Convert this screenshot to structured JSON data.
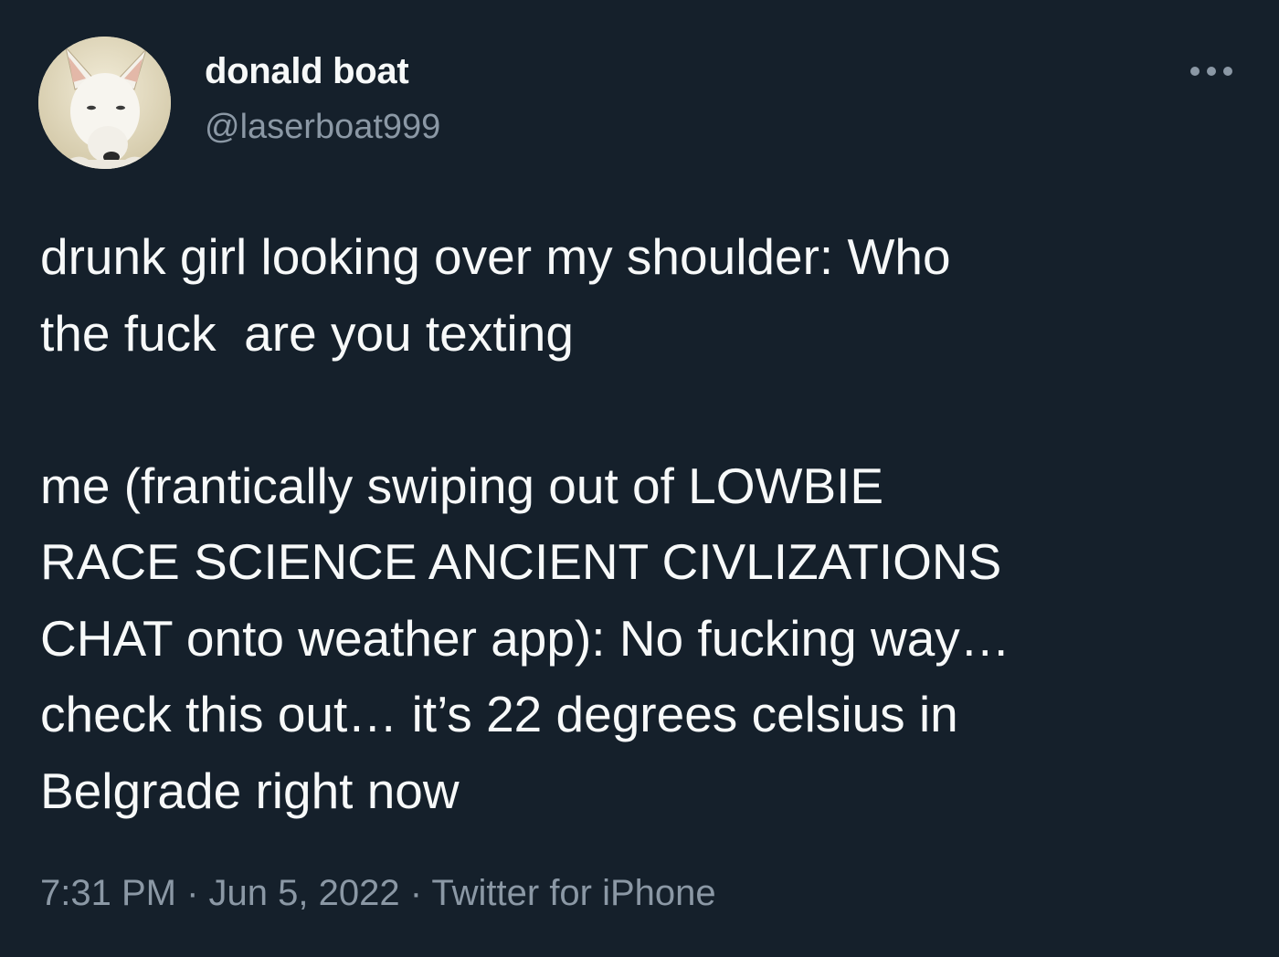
{
  "author": {
    "display_name": "donald boat",
    "handle": "@laserboat999",
    "avatar_icon": "dog-avatar"
  },
  "menu": {
    "more_icon": "more-options-icon"
  },
  "tweet": {
    "text": "drunk girl looking over my shoulder: Who\nthe fuck  are you texting\n\nme (frantically swiping out of LOWBIE\nRACE SCIENCE ANCIENT CIVLIZATIONS\nCHAT onto weather app): No fucking way…\ncheck this out… it’s 22 degrees celsius in\nBelgrade right now"
  },
  "meta": {
    "time": "7:31 PM",
    "separator": " · ",
    "date": "Jun 5, 2022",
    "source": "Twitter for iPhone"
  },
  "colors": {
    "background": "#15202b",
    "text_primary": "#f7f9f9",
    "text_secondary": "#8b98a5"
  }
}
